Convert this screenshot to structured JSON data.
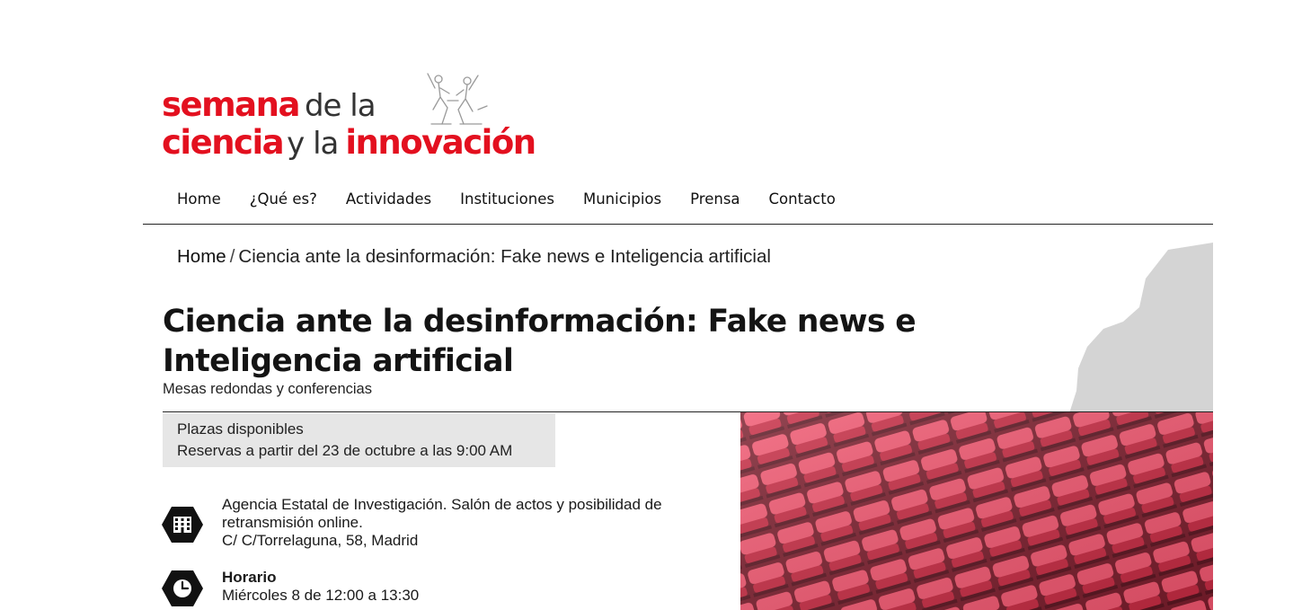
{
  "logo": {
    "semana": "semana",
    "de_la": "de la",
    "ciencia": "ciencia",
    "y_la": "y la",
    "innovacion": "innovación"
  },
  "nav": {
    "items": [
      "Home",
      "¿Qué es?",
      "Actividades",
      "Instituciones",
      "Municipios",
      "Prensa",
      "Contacto"
    ]
  },
  "breadcrumb": {
    "home": "Home",
    "separator": "/",
    "current": "Ciencia ante la desinformación: Fake news e Inteligencia artificial"
  },
  "event": {
    "title": "Ciencia ante la desinformación: Fake news e Inteligencia artificial",
    "subtitle": "Mesas redondas y conferencias"
  },
  "availability": {
    "status": "Plazas disponibles",
    "reservations": "Reservas a partir del 23 de octubre a las 9:00 AM"
  },
  "location": {
    "icon": "building-icon",
    "line1": "Agencia Estatal de Investigación. Salón de actos y posibilidad de",
    "line2": "retransmisión online.",
    "address": "C/ C/Torrelaguna, 58, Madrid"
  },
  "schedule": {
    "icon": "clock-icon",
    "label": "Horario",
    "value": "Miércoles 8 de 12:00 a 13:30"
  },
  "colors": {
    "brand_red": "#e3101f",
    "seat_red": "#e8344f",
    "box_gray": "#e6e6e6"
  }
}
